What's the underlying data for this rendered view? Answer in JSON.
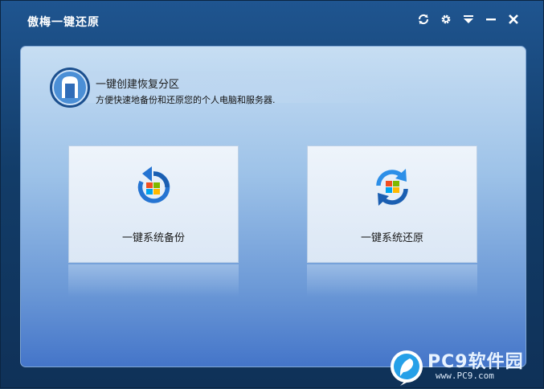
{
  "window": {
    "title": "傲梅一键还原"
  },
  "controls": [
    {
      "name": "refresh-icon"
    },
    {
      "name": "gear-icon"
    },
    {
      "name": "menu-dropdown-icon"
    },
    {
      "name": "minimize-icon"
    },
    {
      "name": "close-icon"
    }
  ],
  "header": {
    "icon": "recovery-partition-icon",
    "title": "一键创建恢复分区",
    "subtitle": "方便快速地备份和还原您的个人电脑和服务器."
  },
  "cards": {
    "backup": {
      "label": "一键系统备份",
      "icon": "backup-icon"
    },
    "restore": {
      "label": "一键系统还原",
      "icon": "restore-icon"
    }
  },
  "watermark": {
    "brand": "PC9软件园",
    "url": "www.PC9.com"
  },
  "colors": {
    "accent_blue": "#1a6fd0",
    "content_top": "#c7def3",
    "content_bottom": "#4475c9"
  }
}
